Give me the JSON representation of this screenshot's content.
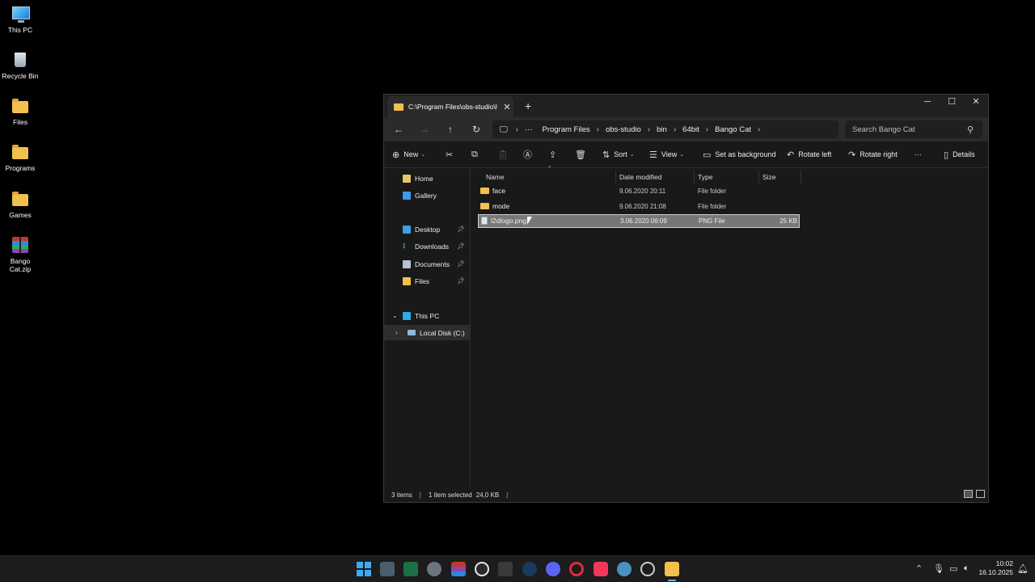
{
  "desktop": {
    "icons": [
      {
        "label": "This PC",
        "icon": "this-pc-icon"
      },
      {
        "label": "Recycle Bin",
        "icon": "recycle-bin-icon"
      },
      {
        "label": "Files",
        "icon": "folder-icon"
      },
      {
        "label": "Programs",
        "icon": "folder-icon"
      },
      {
        "label": "Games",
        "icon": "folder-icon"
      },
      {
        "label": "Bango Cat.zip",
        "icon": "zip-archive-icon"
      }
    ]
  },
  "window": {
    "tab_title": "C:\\Program Files\\obs-studio\\l",
    "new_tab": "+",
    "controls": {
      "minimize": "─",
      "maximize": "☐",
      "close": "✕"
    },
    "nav": {
      "back": "←",
      "forward": "→",
      "up": "↑",
      "refresh": "↻"
    },
    "breadcrumb": [
      "Program Files",
      "obs-studio",
      "bin",
      "64bit",
      "Bango Cat"
    ],
    "search_placeholder": "Search Bango Cat",
    "toolbar": {
      "new": "New",
      "sort": "Sort",
      "view": "View",
      "set_background": "Set as background",
      "rotate_left": "Rotate left",
      "rotate_right": "Rotate right",
      "more": "···",
      "details": "Details"
    },
    "sidebar": {
      "home": "Home",
      "gallery": "Gallery",
      "desktop": "Desktop",
      "downloads": "Downloads",
      "documents": "Documents",
      "files": "Files",
      "this_pc": "This PC",
      "local_disk": "Local Disk (C:)"
    },
    "columns": {
      "name": "Name",
      "date": "Date modified",
      "type": "Type",
      "size": "Size"
    },
    "files": [
      {
        "name": "face",
        "date": "9.06.2020 20:11",
        "type": "File folder",
        "size": "",
        "kind": "folder"
      },
      {
        "name": "mode",
        "date": "9.06.2020 21:08",
        "type": "File folder",
        "size": "",
        "kind": "folder"
      },
      {
        "name": "l2dlogo.png",
        "date": "3.06.2020 06:09",
        "type": "PNG File",
        "size": "25 KB",
        "kind": "png",
        "selected": true
      }
    ],
    "status": {
      "items": "3 items",
      "selected": "1 item selected",
      "size": "24,0 KB",
      "sep": "|"
    }
  },
  "taskbar": {
    "time": "10:02",
    "date": "16.10.2025",
    "apps": [
      "start",
      "calculator",
      "excel",
      "settings",
      "winrar",
      "chrome",
      "terminal",
      "steam",
      "discord",
      "opera",
      "itunes",
      "vpn",
      "clock",
      "file-explorer"
    ],
    "colors": {
      "accent": "#5fb2f2",
      "folder": "#f3c04e"
    }
  }
}
